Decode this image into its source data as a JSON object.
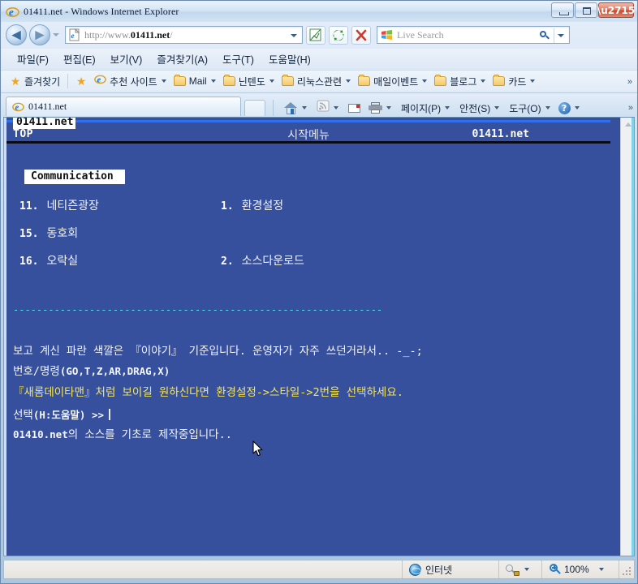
{
  "window": {
    "title": "01411.net - Windows Internet Explorer",
    "icon": "ie-logo-icon",
    "minimize_label": "Minimize",
    "maximize_label": "Maximize",
    "close_label": "Close"
  },
  "nav": {
    "back_label": "◀",
    "forward_label": "▶",
    "history_label": "Recent Pages",
    "address": {
      "prefix": "http://www.",
      "bold": "01411.net",
      "suffix": "/",
      "icon": "page-icon"
    },
    "compat_label": "Compatibility View",
    "refresh_label": "Refresh",
    "stop_label": "Stop",
    "search": {
      "placeholder": "Live Search",
      "provider_icon": "windows-logo-icon",
      "go_label": "Search"
    }
  },
  "menubar": [
    {
      "label": "파일(F)",
      "text": "파일",
      "key": "F"
    },
    {
      "label": "편집(E)",
      "text": "편집",
      "key": "E"
    },
    {
      "label": "보기(V)",
      "text": "보기",
      "key": "V"
    },
    {
      "label": "즐겨찾기(A)",
      "text": "즐겨찾기",
      "key": "A"
    },
    {
      "label": "도구(T)",
      "text": "도구",
      "key": "T"
    },
    {
      "label": "도움말(H)",
      "text": "도움말",
      "key": "H"
    }
  ],
  "favorites": {
    "favorites_button": "즐겨찾기",
    "add_label": "즐겨찾기에 추가",
    "items": [
      {
        "label": "추천 사이트",
        "icon": "ie-logo-icon",
        "dropdown": true
      },
      {
        "label": "Mail",
        "icon": "folder-icon",
        "dropdown": true
      },
      {
        "label": "닌텐도",
        "icon": "folder-icon",
        "dropdown": true
      },
      {
        "label": "리눅스관련",
        "icon": "folder-icon",
        "dropdown": true
      },
      {
        "label": "매일이벤트",
        "icon": "folder-icon",
        "dropdown": true
      },
      {
        "label": "블로그",
        "icon": "folder-icon",
        "dropdown": true
      },
      {
        "label": "카드",
        "icon": "folder-icon",
        "dropdown": true
      }
    ],
    "overflow": "»"
  },
  "tabs": {
    "items": [
      {
        "label": "01411.net",
        "icon": "ie-logo-icon",
        "active": true
      }
    ],
    "new_tab_label": "",
    "commands": [
      {
        "label": "",
        "icon": "home-icon",
        "dropdown": true
      },
      {
        "label": "",
        "icon": "rss-feed-icon",
        "dropdown": true
      },
      {
        "label": "",
        "icon": "mail-icon",
        "dropdown": false
      },
      {
        "label": "",
        "icon": "print-icon",
        "dropdown": true
      },
      {
        "label": "페이지(P)",
        "icon": "",
        "dropdown": true
      },
      {
        "label": "안전(S)",
        "icon": "",
        "dropdown": true
      },
      {
        "label": "도구(O)",
        "icon": "",
        "dropdown": true
      },
      {
        "label": "",
        "icon": "help-icon",
        "dropdown": true
      }
    ],
    "overflow": "»"
  },
  "page": {
    "site_tag": "01411.net",
    "header": {
      "left": "TOP",
      "center": "시작메뉴",
      "right": "01411.net"
    },
    "section_tag": "Communication",
    "menu_left": [
      {
        "num": "11.",
        "label": "네티즌광장"
      },
      {
        "num": "15.",
        "label": "동호회"
      },
      {
        "num": "16.",
        "label": "오락실"
      }
    ],
    "menu_right": [
      {
        "num": "1.",
        "label": "환경설정"
      },
      {
        "num": "",
        "label": ""
      },
      {
        "num": "2.",
        "label": "소스다운로드"
      }
    ],
    "divider": "---------------------------------------------------------------",
    "notice_line1": "보고 계신 파란 색깔은 『이야기』 기준입니다. 운영자가 자주 쓰던거라서.. -_-;",
    "notice_line2": "『새롬데이타맨』처럼 보이길 원하신다면 환경설정->스타일->2번을 선택하세요.",
    "notice_line3_mono": "01410.net",
    "notice_line3_rest": "의 소스를 기초로 제작중입니다..",
    "prompt_line1_ko": "번호/명령",
    "prompt_line1_cmd": "(GO,T,Z,AR,DRAG,X)",
    "prompt_line2_ko": "선택",
    "prompt_line2_cmd": "(H:도움말) >>",
    "colors": {
      "background": "#36509e",
      "text": "#ffffff",
      "accent_yellow": "#f6e65a",
      "accent_cyan": "#4fe3e8",
      "rule_blue": "#2f6ff0",
      "rule_black": "#0a0a16"
    }
  },
  "statusbar": {
    "zone_label": "인터넷",
    "zone_icon": "internet-globe-icon",
    "protected_icon": "protected-mode-icon",
    "zoom_label": "100%",
    "zoom_icon": "zoom-in-icon"
  }
}
